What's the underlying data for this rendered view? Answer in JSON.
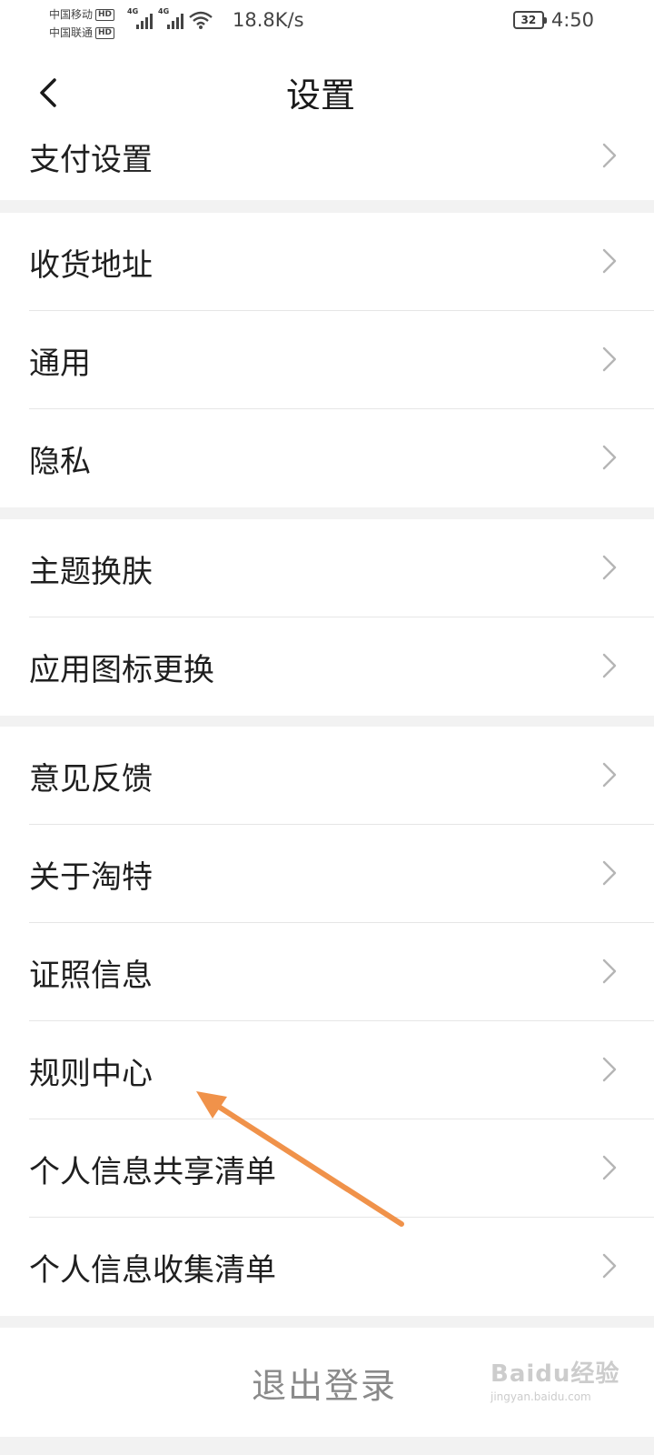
{
  "status_bar": {
    "carrier1": "中国移动",
    "carrier2": "中国联通",
    "hd": "HD",
    "net1": "4G",
    "net2": "4G",
    "speed": "18.8K/s",
    "battery": "32",
    "time": "4:50"
  },
  "header": {
    "title": "设置",
    "back_icon": "chevron-left-icon"
  },
  "groups": [
    {
      "items": [
        "支付设置"
      ]
    },
    {
      "items": [
        "收货地址",
        "通用",
        "隐私"
      ]
    },
    {
      "items": [
        "主题换肤",
        "应用图标更换"
      ]
    },
    {
      "items": [
        "意见反馈",
        "关于淘特",
        "证照信息",
        "规则中心",
        "个人信息共享清单",
        "个人信息收集清单"
      ]
    }
  ],
  "logout_label": "退出登录",
  "annotation_color": "#f0924a",
  "watermark": {
    "main": "Baidu经验",
    "sub": "jingyan.baidu.com"
  }
}
